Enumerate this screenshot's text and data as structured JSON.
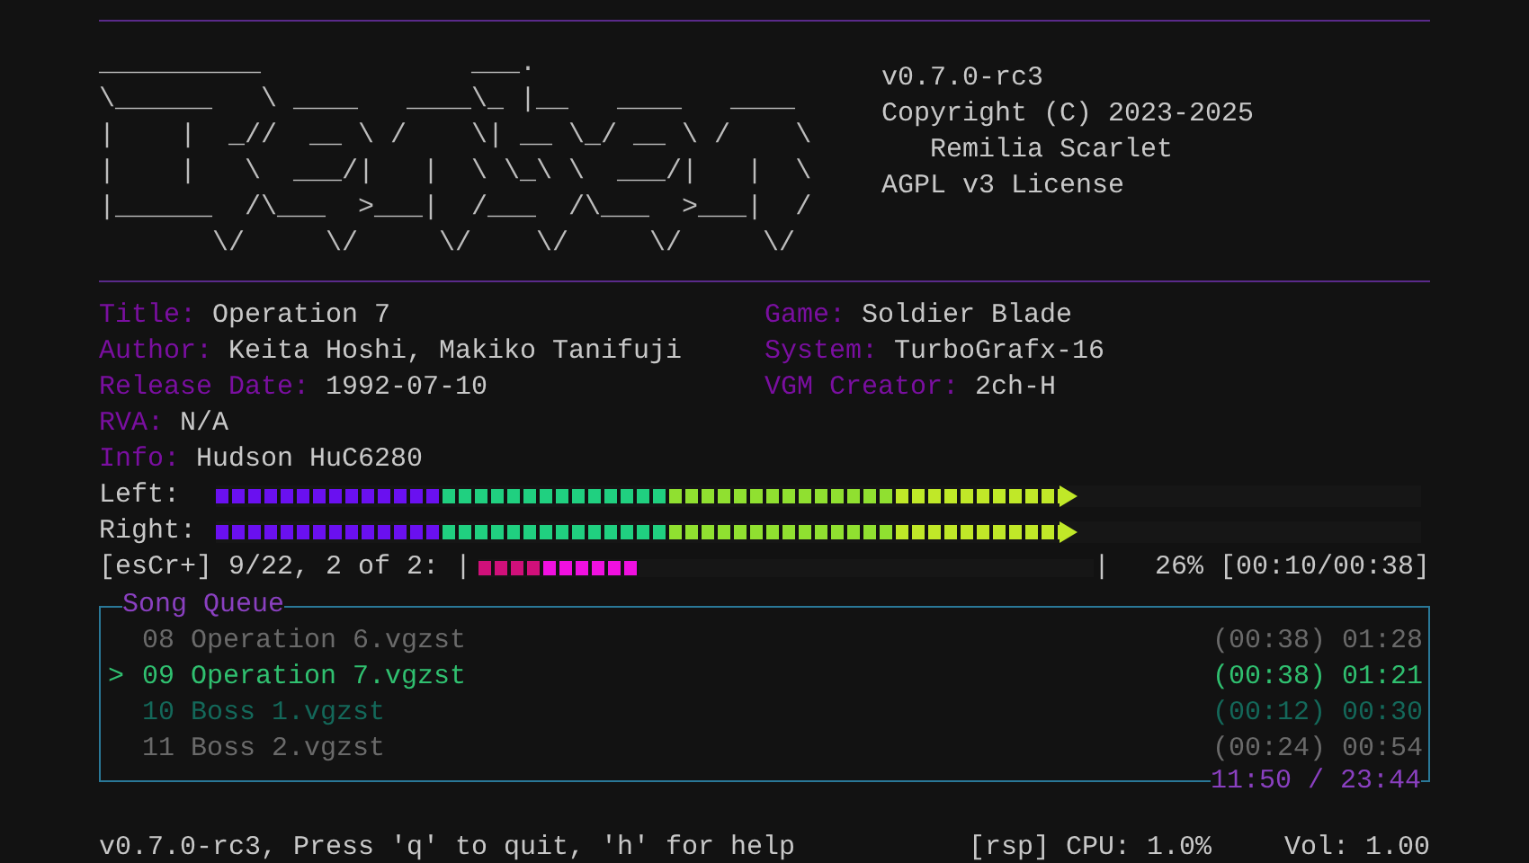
{
  "logo_lines": [
    "__________             ___.",
    "\\______   \\ ____   ____\\_ |__   ____   ____",
    "|    |  _//  __ \\ /    \\| __ \\_/ __ \\ /    \\",
    "|    |   \\  ___/|   |  \\ \\_\\ \\  ___/|   |  \\",
    "|______  /\\___  >___|  /___  /\\___  >___|  /",
    "       \\/     \\/     \\/    \\/     \\/     \\/"
  ],
  "about": [
    "v0.7.0-rc3",
    "Copyright (C) 2023-2025",
    "   Remilia Scarlet",
    "AGPL v3 License"
  ],
  "info_left": [
    {
      "label": "Title:",
      "value": "Operation 7"
    },
    {
      "label": "Author:",
      "value": "Keita Hoshi, Makiko Tanifuji"
    },
    {
      "label": "Release Date:",
      "value": "1992-07-10"
    },
    {
      "label": "RVA:",
      "value": "N/A"
    },
    {
      "label": "Info:",
      "value": "Hudson HuC6280"
    }
  ],
  "info_right": [
    {
      "label": "Game:",
      "value": "Soldier Blade"
    },
    {
      "label": "System:",
      "value": "TurboGrafx-16"
    },
    {
      "label": "VGM Creator:",
      "value": "2ch-H"
    }
  ],
  "meters": [
    {
      "label": "Left:",
      "level": 0.7
    },
    {
      "label": "Right:",
      "level": 0.7
    }
  ],
  "progress": {
    "prefix": "[esCr+] 9/22, 2 of 2: |",
    "level": 0.26,
    "suffix": "|",
    "reading": "26% [00:10/00:38]"
  },
  "queue": {
    "title": "Song Queue",
    "total": "11:50 / 23:44",
    "rows": [
      {
        "marker": "",
        "name": "08 Operation 6.vgzst",
        "times": "(00:38) 01:28",
        "selected": false,
        "kind": "normal"
      },
      {
        "marker": ">",
        "name": "09 Operation 7.vgzst",
        "times": "(00:38) 01:21",
        "selected": true,
        "kind": "normal"
      },
      {
        "marker": "",
        "name": "10 Boss 1.vgzst",
        "times": "(00:12) 00:30",
        "selected": false,
        "kind": "next"
      },
      {
        "marker": "",
        "name": "11 Boss 2.vgzst",
        "times": "(00:24) 00:54",
        "selected": false,
        "kind": "normal"
      }
    ]
  },
  "status_bar": {
    "help": "v0.7.0-rc3, Press 'q' to quit, 'h' for help",
    "cpu": "[rsp] CPU: 1.0%",
    "volume": "Vol: 1.00"
  }
}
